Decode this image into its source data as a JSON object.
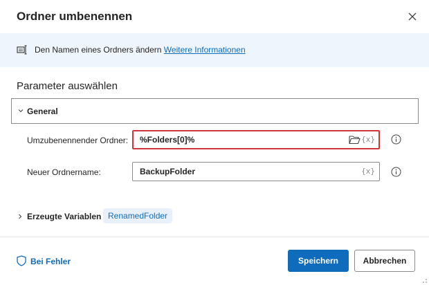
{
  "dialog": {
    "title": "Ordner umbenennen"
  },
  "info": {
    "text": "Den Namen eines Ordners ändern",
    "link": "Weitere Informationen"
  },
  "parameters": {
    "heading": "Parameter auswählen",
    "group_label": "General",
    "fields": [
      {
        "label": "Umzubenennender Ordner:",
        "value": "%Folders[0]%",
        "var_icon": "{x}"
      },
      {
        "label": "Neuer Ordnername:",
        "value": "BackupFolder",
        "var_icon": "{x}"
      }
    ]
  },
  "produced": {
    "label": "Erzeugte Variablen",
    "variable": "RenamedFolder"
  },
  "footer": {
    "on_error": "Bei Fehler",
    "save": "Speichern",
    "cancel": "Abbrechen"
  },
  "colors": {
    "accent": "#0f6cbd",
    "highlight_border": "#d13438",
    "banner_bg": "#eff5fc"
  },
  "icons": {
    "close": "close-icon",
    "info": "action-info-icon",
    "folder": "folder-open-icon",
    "help": "info-circle-icon",
    "shield": "shield-icon"
  }
}
